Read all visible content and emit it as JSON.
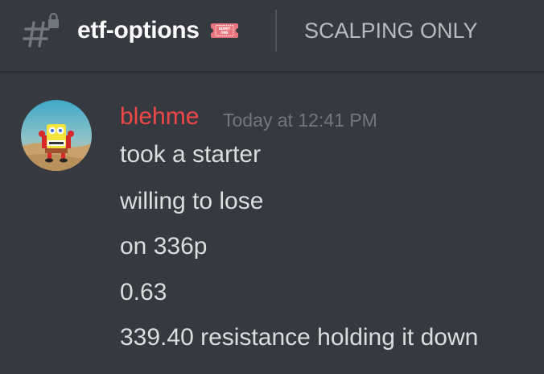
{
  "header": {
    "channel_name": "etf-options",
    "topic": "SCALPING ONLY",
    "channel_icon": "hashtag-lock-icon",
    "emoji": "admit-one-ticket-emoji",
    "ticket_text": "ADMIT ONE"
  },
  "message": {
    "author": "blehme",
    "author_color": "#f04747",
    "timestamp": "Today at 12:41 PM",
    "avatar_icon": "cartoon-avatar",
    "lines": [
      "took a starter",
      "willing to lose",
      "on 336p",
      "0.63",
      "339.40 resistance holding it down"
    ]
  }
}
